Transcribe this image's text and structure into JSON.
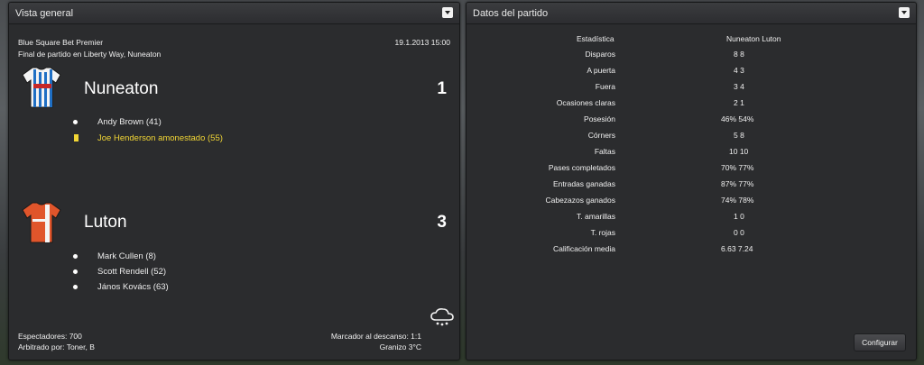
{
  "overview": {
    "title": "Vista general",
    "competition": "Blue Square Bet Premier",
    "datetime": "19.1.2013 15:00",
    "venue": "Final de partido en Liberty Way, Nuneaton",
    "home": {
      "name": "Nuneaton",
      "score": "1",
      "events": [
        {
          "type": "goal",
          "text": "Andy Brown (41)"
        },
        {
          "type": "yellow-card",
          "text": "Joe Henderson amonestado (55)"
        }
      ]
    },
    "away": {
      "name": "Luton",
      "score": "3",
      "events": [
        {
          "type": "goal",
          "text": "Mark Cullen (8)"
        },
        {
          "type": "goal",
          "text": "Scott Rendell (52)"
        },
        {
          "type": "goal",
          "text": "János Kovács (63)"
        }
      ]
    },
    "attendance": "Espectadores: 700",
    "referee": "Arbitrado por: Toner, B",
    "halftime": "Marcador al descanso: 1:1",
    "weather": "Granizo 3°C",
    "weather_icon": "cloud-hail-icon"
  },
  "match_stats": {
    "title": "Datos del partido",
    "header_stat": "Estadística",
    "header_teams": "Nuneaton  Luton",
    "rows": [
      {
        "label": "Disparos",
        "values": "8 8"
      },
      {
        "label": "A puerta",
        "values": "4 3"
      },
      {
        "label": "Fuera",
        "values": "3 4"
      },
      {
        "label": "Ocasiones claras",
        "values": "2 1"
      },
      {
        "label": "Posesión",
        "values": "46% 54%"
      },
      {
        "label": "Córners",
        "values": "5 8"
      },
      {
        "label": "Faltas",
        "values": "10 10"
      },
      {
        "label": "Pases completados",
        "values": "70% 77%"
      },
      {
        "label": "Entradas ganadas",
        "values": "87% 77%"
      },
      {
        "label": "Cabezazos ganados",
        "values": "74% 78%"
      },
      {
        "label": "T. amarillas",
        "values": "1 0"
      },
      {
        "label": "T. rojas",
        "values": "0 0"
      },
      {
        "label": "Calificación media",
        "values": "6.63 7.24"
      }
    ],
    "configure_label": "Configurar"
  },
  "colors": {
    "panel_bg": "#2b2c2e",
    "yellow_card": "#f2d635",
    "home_kit": "#1f6fc4",
    "away_kit": "#e0552b"
  }
}
